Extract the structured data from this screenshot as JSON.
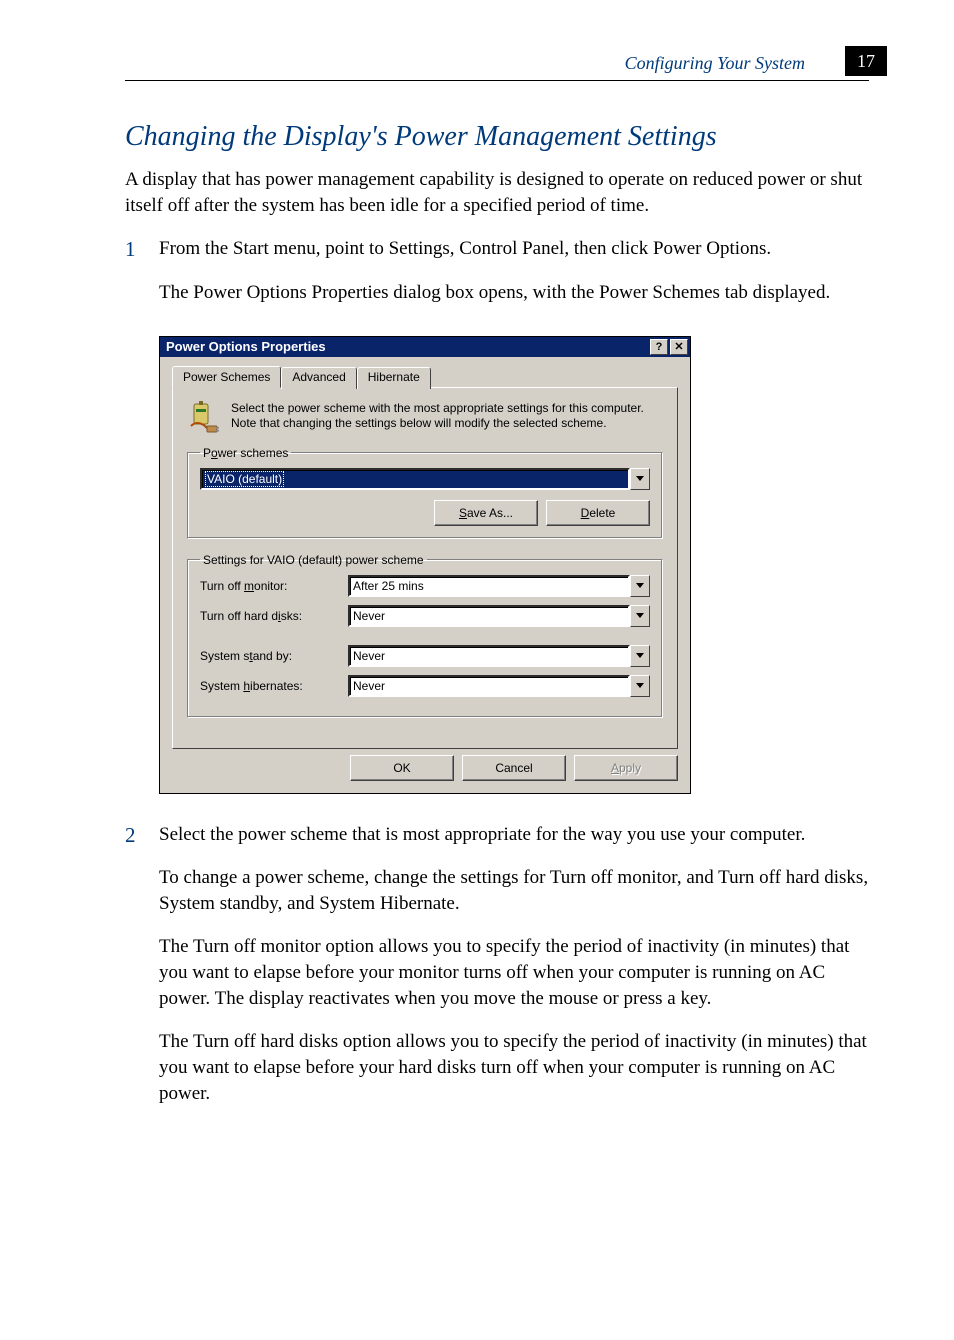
{
  "header": {
    "section": "Configuring Your System",
    "page_number": "17"
  },
  "title": "Changing the Display's Power Management Settings",
  "intro": "A display that has power management capability is designed to operate on reduced power or shut itself off after the system has been idle for a specified period of time.",
  "steps": [
    {
      "num": "1",
      "paras": [
        "From the Start menu, point to Settings, Control Panel, then click Power Options.",
        "The Power Options Properties dialog box opens, with the Power Schemes tab displayed."
      ]
    },
    {
      "num": "2",
      "paras": [
        "Select the power scheme that is most appropriate for the way you use your computer.",
        "To change a power scheme, change the settings for Turn off monitor, and Turn off hard disks, System standby, and System Hibernate.",
        "The Turn off monitor option allows you to specify the period of inactivity (in minutes) that you want to elapse before your monitor turns off when your computer is running on AC power. The display reactivates when you move the mouse or press a key.",
        "The Turn off hard disks option allows you to specify the period of inactivity (in minutes) that you want to elapse before your hard disks turn off when your computer is running on AC power."
      ]
    }
  ],
  "dialog": {
    "title": "Power Options Properties",
    "tabs": [
      "Power Schemes",
      "Advanced",
      "Hibernate"
    ],
    "info_text": "Select the power scheme with the most appropriate settings for this computer. Note that changing the settings below will modify the selected scheme.",
    "schemes_group": {
      "legend_pre": "P",
      "legend_u": "o",
      "legend_post": "wer schemes",
      "selected": "VAIO (default)",
      "save_pre": "",
      "save_u": "S",
      "save_post": "ave As...",
      "delete_pre": "",
      "delete_u": "D",
      "delete_post": "elete"
    },
    "settings_group": {
      "legend": "Settings for VAIO (default) power scheme",
      "rows": [
        {
          "pre": "Turn off ",
          "u": "m",
          "post": "onitor:",
          "value": "After 25 mins"
        },
        {
          "pre": "Turn off hard d",
          "u": "i",
          "post": "sks:",
          "value": "Never"
        },
        {
          "pre": "System s",
          "u": "t",
          "post": "and by:",
          "value": "Never"
        },
        {
          "pre": "System ",
          "u": "h",
          "post": "ibernates:",
          "value": "Never"
        }
      ]
    },
    "footer": {
      "ok": "OK",
      "cancel": "Cancel",
      "apply_u": "A",
      "apply_post": "pply"
    }
  }
}
